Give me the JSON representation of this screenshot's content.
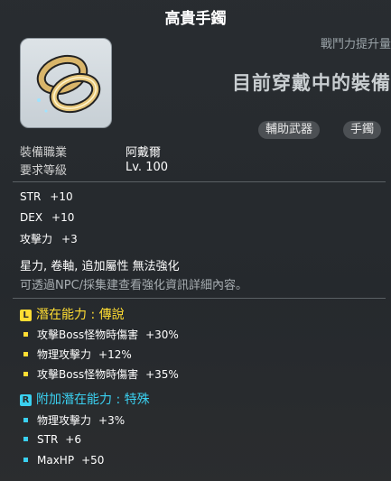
{
  "item": {
    "name": "高貴手鐲",
    "icon": "ring-bracelet-icon"
  },
  "comparison": {
    "power_label": "戰鬥力提升量",
    "equipped_label": "目前穿戴中的裝備"
  },
  "tags": [
    "輔助武器",
    "手鐲"
  ],
  "requirements": {
    "job_label": "裝備職業",
    "job_value": "阿戴爾",
    "level_label": "要求等級",
    "level_value": "Lv. 100"
  },
  "stats": [
    {
      "name": "STR",
      "value": "+10"
    },
    {
      "name": "DEX",
      "value": "+10"
    },
    {
      "name": "攻擊力",
      "value": "+3"
    }
  ],
  "notes": {
    "restrictions": "星力, 卷軸, 追加屬性 無法強化",
    "hint": "可透過NPC/採集建查看強化資訊詳細內容。"
  },
  "potential": {
    "badge": "L",
    "title": "潛在能力 : 傳說",
    "color": "#ffdd33",
    "lines": [
      {
        "text": "攻擊Boss怪物時傷害",
        "value": "+30%"
      },
      {
        "text": "物理攻擊力",
        "value": "+12%"
      },
      {
        "text": "攻擊Boss怪物時傷害",
        "value": "+35%"
      }
    ]
  },
  "additional_potential": {
    "badge": "R",
    "title": "附加潛在能力 : 特殊",
    "color": "#3ad0f0",
    "lines": [
      {
        "text": "物理攻擊力",
        "value": "+3%"
      },
      {
        "text": "STR",
        "value": "+6"
      },
      {
        "text": "MaxHP",
        "value": "+50"
      }
    ]
  }
}
